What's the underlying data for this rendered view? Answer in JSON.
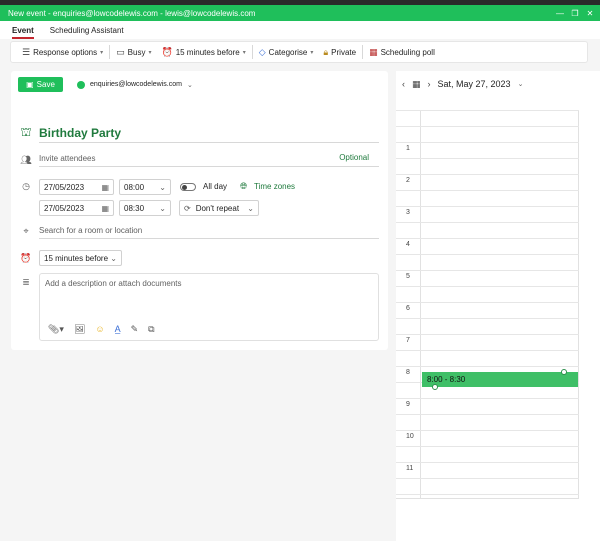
{
  "titlebar": {
    "title": "New event - enquiries@lowcodelewis.com - lewis@lowcodelewis.com"
  },
  "tabs": [
    {
      "label": "Event",
      "active": true
    },
    {
      "label": "Scheduling Assistant",
      "active": false
    }
  ],
  "toolbar": {
    "response_options": "Response options",
    "busy": "Busy",
    "reminder": "15 minutes before",
    "categorise": "Categorise",
    "private": "Private",
    "scheduling_poll": "Scheduling poll"
  },
  "form": {
    "save_label": "Save",
    "account": "enquiries@lowcodelewis.com",
    "title": "Birthday Party",
    "attendees_placeholder": "Invite attendees",
    "optional_label": "Optional",
    "start_date": "27/05/2023",
    "start_time": "08:00",
    "end_date": "27/05/2023",
    "end_time": "08:30",
    "all_day_label": "All day",
    "time_zones_label": "Time zones",
    "repeat_label": "Don't repeat",
    "location_placeholder": "Search for a room or location",
    "reminder_value": "15 minutes before",
    "description_placeholder": "Add a description or attach documents"
  },
  "calendar": {
    "date": "Sat, May 27, 2023",
    "hours": [
      "1",
      "2",
      "3",
      "4",
      "5",
      "6",
      "7",
      "8",
      "9",
      "10",
      "11"
    ],
    "event_label": "8:00 - 8:30"
  },
  "colors": {
    "accent": "#1fbf5b",
    "title_text": "#1f7a3d",
    "event": "#3fbf67",
    "active_tab_underline": "#c4262e"
  }
}
